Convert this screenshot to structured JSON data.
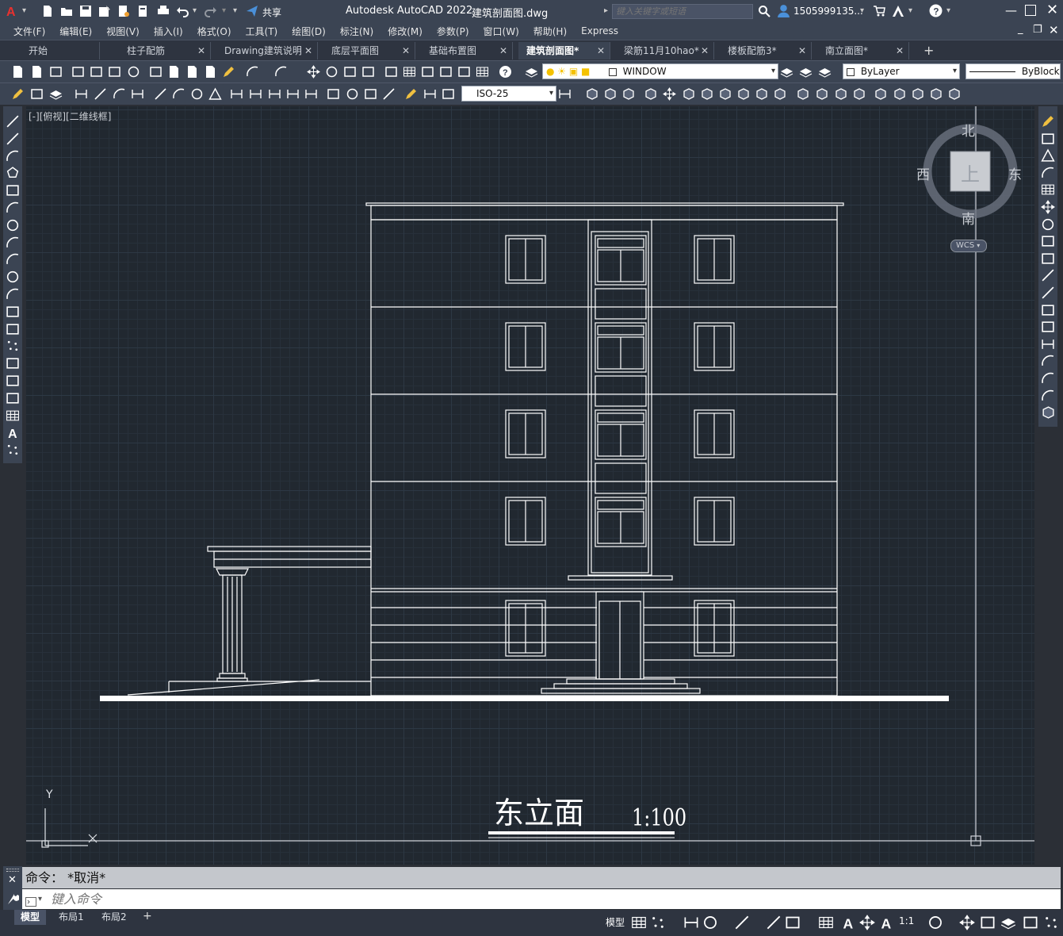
{
  "titlebar": {
    "app_title": "Autodesk AutoCAD 2022",
    "file_name": "建筑剖面图.dwg",
    "share_label": "共享",
    "search_placeholder": "键入关键字或短语",
    "user_name": "1505999135..."
  },
  "menus": [
    "文件(F)",
    "编辑(E)",
    "视图(V)",
    "插入(I)",
    "格式(O)",
    "工具(T)",
    "绘图(D)",
    "标注(N)",
    "修改(M)",
    "参数(P)",
    "窗口(W)",
    "帮助(H)",
    "Express"
  ],
  "tabs": [
    {
      "label": "开始",
      "closable": false,
      "active": false
    },
    {
      "label": "柱子配筋",
      "closable": true,
      "active": false
    },
    {
      "label": "Drawing建筑说明",
      "closable": true,
      "active": false
    },
    {
      "label": "底层平面图",
      "closable": true,
      "active": false
    },
    {
      "label": "基础布置图",
      "closable": true,
      "active": false
    },
    {
      "label": "建筑剖面图*",
      "closable": true,
      "active": true
    },
    {
      "label": "梁筋11月10hao*",
      "closable": true,
      "active": false
    },
    {
      "label": "楼板配筋3*",
      "closable": true,
      "active": false
    },
    {
      "label": "南立面图*",
      "closable": true,
      "active": false
    }
  ],
  "toolbar": {
    "layer_combo": "WINDOW",
    "color_combo": "ByLayer",
    "linetype_combo": "ByBlock",
    "dimstyle_combo": "ISO-25"
  },
  "viewport": {
    "label": "[-][俯视][二维线框]"
  },
  "viewcube": {
    "north": "北",
    "south": "南",
    "east": "东",
    "west": "西",
    "top": "上",
    "wcs": "WCS"
  },
  "ucs": {
    "y_label": "Y",
    "x_label": "X"
  },
  "drawing": {
    "title": "东立面",
    "scale": "1:100"
  },
  "command": {
    "history": "命令：  *取消*",
    "input_placeholder": "键入命令"
  },
  "status": {
    "layout_tabs": [
      "模型",
      "布局1",
      "布局2"
    ],
    "model_label": "模型",
    "scale_label": "1:1"
  },
  "colors": {
    "ui_bg": "#3b4453",
    "canvas_bg": "#212830",
    "accent": "#4a90d9",
    "lines": "#ffffff"
  }
}
